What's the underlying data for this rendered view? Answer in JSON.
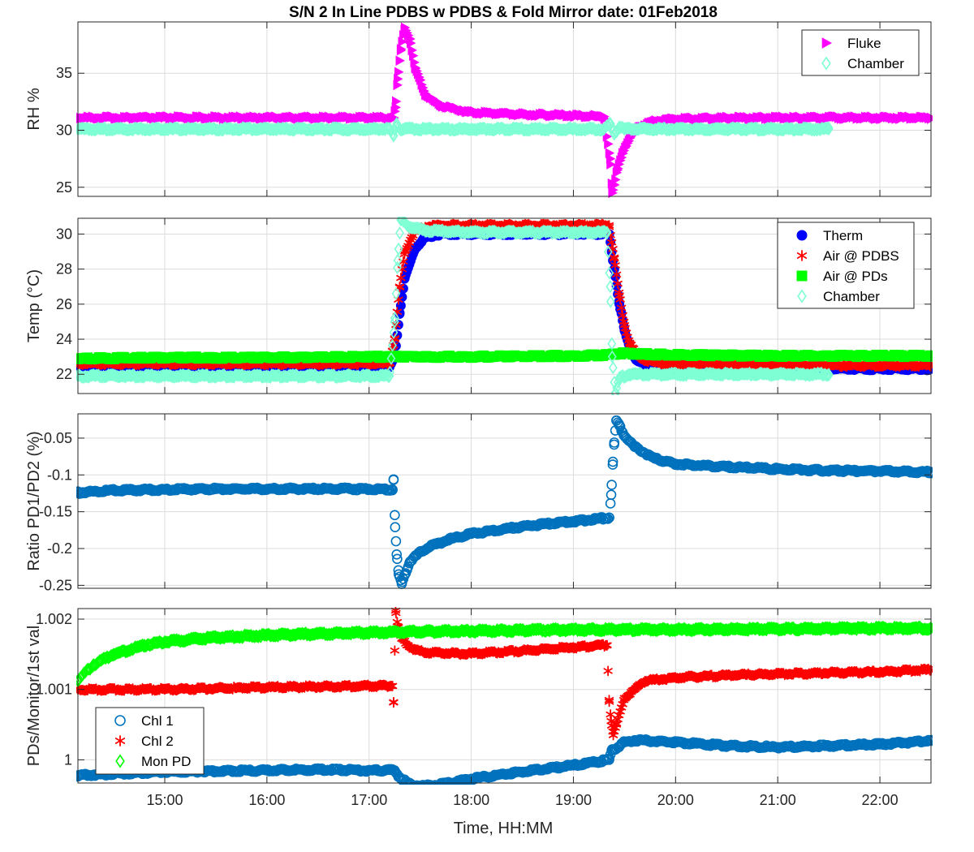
{
  "figure": {
    "title": "S/N 2 In Line PDBS w PDBS & Fold Mirror date: 01Feb2018",
    "xlabel": "Time, HH:MM"
  },
  "chart_data": [
    {
      "type": "scatter",
      "ylabel": "RH %",
      "xlim": [
        14.15,
        22.5
      ],
      "ylim": [
        24.2,
        39.5
      ],
      "yticks": [
        25,
        30,
        35
      ],
      "ytick_labels": [
        "25",
        "30",
        "35"
      ],
      "xticks": [
        15,
        16,
        17,
        18,
        19,
        20,
        21,
        22
      ],
      "xtick_labels": [
        "15:00",
        "16:00",
        "17:00",
        "18:00",
        "19:00",
        "20:00",
        "21:00",
        "22:00"
      ],
      "show_xtick_labels": false,
      "grid": true,
      "legend_position": "top-right",
      "series": [
        {
          "name": "Fluke",
          "marker": "triangle-right",
          "color": "#ff00ff",
          "x": [
            14.15,
            15.0,
            16.0,
            17.0,
            17.24,
            17.26,
            17.28,
            17.31,
            17.35,
            17.4,
            17.45,
            17.55,
            17.7,
            18.0,
            18.5,
            19.0,
            19.3,
            19.36,
            19.38,
            19.4,
            19.43,
            19.48,
            19.55,
            19.65,
            19.8,
            20.0,
            21.0,
            22.0,
            22.5
          ],
          "y": [
            31.1,
            31.1,
            31.1,
            31.1,
            31.1,
            32.0,
            34.5,
            37.0,
            39.0,
            38.0,
            35.5,
            33.2,
            32.2,
            31.6,
            31.4,
            31.3,
            31.2,
            27.5,
            24.5,
            25.2,
            26.5,
            28.0,
            29.3,
            30.3,
            30.8,
            31.0,
            31.1,
            31.1,
            31.1
          ]
        },
        {
          "name": "Chamber",
          "marker": "diamond-open",
          "color": "#7fffd4",
          "x": [
            14.15,
            15.0,
            16.0,
            17.0,
            17.2,
            17.24,
            17.27,
            17.3,
            18.0,
            19.0,
            19.3,
            19.36,
            19.4,
            19.45,
            19.5,
            20.0,
            21.0,
            21.5
          ],
          "y": [
            30.1,
            30.1,
            30.1,
            30.1,
            30.1,
            29.5,
            30.6,
            30.1,
            30.1,
            30.1,
            30.1,
            30.6,
            29.7,
            30.3,
            30.1,
            30.1,
            30.1,
            30.1
          ]
        }
      ]
    },
    {
      "type": "scatter",
      "ylabel": "Temp (°C)",
      "xlim": [
        14.15,
        22.5
      ],
      "ylim": [
        20.9,
        30.9
      ],
      "yticks": [
        22,
        24,
        26,
        28,
        30
      ],
      "ytick_labels": [
        "22",
        "24",
        "26",
        "28",
        "30"
      ],
      "show_xtick_labels": false,
      "grid": true,
      "legend_position": "top-right",
      "series": [
        {
          "name": "Therm",
          "marker": "circle-filled",
          "color": "#0000ff",
          "x": [
            14.15,
            15.0,
            16.0,
            17.0,
            17.2,
            17.25,
            17.3,
            17.35,
            17.45,
            17.55,
            17.7,
            18.0,
            19.0,
            19.35,
            19.4,
            19.45,
            19.5,
            19.55,
            19.62,
            19.7,
            19.85,
            20.0,
            21.0,
            22.0,
            22.5
          ],
          "y": [
            22.4,
            22.4,
            22.4,
            22.4,
            22.4,
            23.0,
            25.5,
            27.5,
            29.2,
            29.8,
            30.0,
            30.0,
            30.0,
            30.0,
            28.0,
            26.0,
            24.5,
            23.5,
            22.8,
            22.5,
            22.4,
            22.35,
            22.3,
            22.3,
            22.3
          ]
        },
        {
          "name": "Air @ PDBS",
          "marker": "asterisk",
          "color": "#ff0000",
          "x": [
            14.15,
            15.0,
            16.0,
            17.0,
            17.2,
            17.25,
            17.3,
            17.35,
            17.45,
            17.55,
            17.7,
            18.0,
            19.0,
            19.35,
            19.4,
            19.45,
            19.5,
            19.55,
            19.62,
            19.7,
            19.85,
            20.0,
            21.0,
            22.0,
            22.5
          ],
          "y": [
            22.6,
            22.6,
            22.6,
            22.6,
            22.6,
            24.0,
            27.0,
            29.0,
            30.2,
            30.4,
            30.5,
            30.5,
            30.5,
            30.5,
            28.6,
            26.5,
            24.8,
            23.8,
            23.1,
            22.8,
            22.6,
            22.6,
            22.5,
            22.5,
            22.5
          ]
        },
        {
          "name": "Air @ PDs",
          "marker": "square-filled",
          "color": "#00ff00",
          "x": [
            14.15,
            15.0,
            16.0,
            17.0,
            18.0,
            19.0,
            19.35,
            19.45,
            20.0,
            21.0,
            22.0,
            22.5
          ],
          "y": [
            22.9,
            22.95,
            22.95,
            23.0,
            23.0,
            23.05,
            23.1,
            23.2,
            23.1,
            23.05,
            23.05,
            23.05
          ]
        },
        {
          "name": "Chamber",
          "marker": "diamond-open",
          "color": "#7fffd4",
          "x": [
            14.15,
            15.0,
            16.0,
            17.0,
            17.2,
            17.25,
            17.28,
            17.31,
            17.4,
            17.55,
            18.0,
            19.0,
            19.33,
            19.36,
            19.38,
            19.41,
            19.45,
            19.55,
            20.0,
            21.0,
            21.5
          ],
          "y": [
            21.9,
            21.9,
            21.9,
            21.9,
            21.9,
            25.0,
            28.5,
            30.8,
            30.4,
            30.2,
            30.1,
            30.1,
            30.1,
            27.0,
            23.0,
            20.9,
            21.8,
            22.0,
            22.0,
            22.0,
            22.0
          ]
        }
      ]
    },
    {
      "type": "scatter",
      "ylabel": "Ratio PD1/PD2 (%)",
      "xlim": [
        14.15,
        22.5
      ],
      "ylim": [
        -0.254,
        -0.017
      ],
      "yticks": [
        -0.25,
        -0.2,
        -0.15,
        -0.1,
        -0.05
      ],
      "ytick_labels": [
        "-0.25",
        "-0.2",
        "-0.15",
        "-0.1",
        "-0.05"
      ],
      "show_xtick_labels": false,
      "grid": true,
      "series": [
        {
          "name": "",
          "marker": "circle-open",
          "color": "#0072bd",
          "x": [
            14.15,
            14.5,
            15.0,
            15.5,
            16.0,
            16.5,
            17.0,
            17.23,
            17.24,
            17.255,
            17.27,
            17.29,
            17.32,
            17.35,
            17.4,
            17.5,
            17.6,
            17.8,
            18.0,
            18.5,
            19.0,
            19.35,
            19.37,
            19.385,
            19.4,
            19.42,
            19.45,
            19.5,
            19.6,
            19.8,
            20.0,
            20.5,
            21.0,
            21.5,
            22.0,
            22.5
          ],
          "y": [
            -0.124,
            -0.121,
            -0.12,
            -0.119,
            -0.119,
            -0.119,
            -0.119,
            -0.12,
            -0.106,
            -0.171,
            -0.208,
            -0.235,
            -0.248,
            -0.235,
            -0.218,
            -0.205,
            -0.197,
            -0.187,
            -0.18,
            -0.17,
            -0.163,
            -0.158,
            -0.127,
            -0.086,
            -0.056,
            -0.026,
            -0.033,
            -0.047,
            -0.062,
            -0.078,
            -0.085,
            -0.089,
            -0.092,
            -0.094,
            -0.095,
            -0.096
          ]
        }
      ]
    },
    {
      "type": "scatter",
      "ylabel": "PDs/Monitor/1st val",
      "xlim": [
        14.15,
        22.5
      ],
      "ylim": [
        0.99967,
        1.00215
      ],
      "yticks": [
        1.0,
        1.001,
        1.002
      ],
      "ytick_labels": [
        "1",
        "1.001",
        "1.002"
      ],
      "xticks": [
        15,
        16,
        17,
        18,
        19,
        20,
        21,
        22
      ],
      "xtick_labels": [
        "15:00",
        "16:00",
        "17:00",
        "18:00",
        "19:00",
        "20:00",
        "21:00",
        "22:00"
      ],
      "show_xtick_labels": true,
      "grid": true,
      "legend_position": "bottom-left",
      "series": [
        {
          "name": "Chl 1",
          "marker": "circle-open",
          "color": "#0072bd",
          "x": [
            14.15,
            15.0,
            16.0,
            16.5,
            17.0,
            17.25,
            17.3,
            17.4,
            17.5,
            17.7,
            18.0,
            18.5,
            19.0,
            19.35,
            19.38,
            19.4,
            19.5,
            19.6,
            20.0,
            20.5,
            21.0,
            22.0,
            22.5
          ],
          "y": [
            0.99978,
            0.99983,
            0.99985,
            0.99986,
            0.99985,
            0.99985,
            0.99975,
            0.99965,
            0.99963,
            0.99965,
            0.99973,
            0.99983,
            0.99992,
            1.0,
            1.00015,
            1.00015,
            1.00025,
            1.00028,
            1.00025,
            1.0002,
            1.00018,
            1.00022,
            1.00027
          ]
        },
        {
          "name": "Chl 2",
          "marker": "asterisk",
          "color": "#ff0000",
          "x": [
            14.15,
            15.0,
            16.0,
            17.0,
            17.23,
            17.24,
            17.26,
            17.28,
            17.32,
            17.38,
            17.45,
            17.6,
            18.0,
            18.5,
            19.0,
            19.33,
            19.35,
            19.37,
            19.39,
            19.42,
            19.5,
            19.7,
            20.0,
            20.5,
            21.0,
            22.0,
            22.5
          ],
          "y": [
            1.001,
            1.001,
            1.00103,
            1.00105,
            1.00105,
            1.00082,
            1.00212,
            1.0019,
            1.00172,
            1.00163,
            1.00156,
            1.00152,
            1.00151,
            1.00155,
            1.0016,
            1.00163,
            1.00085,
            1.00055,
            1.00035,
            1.0005,
            1.00088,
            1.00112,
            1.00117,
            1.0012,
            1.00122,
            1.00125,
            1.00128
          ]
        },
        {
          "name": "Mon PD",
          "marker": "diamond-open",
          "color": "#00ff00",
          "x": [
            14.15,
            14.3,
            14.5,
            14.8,
            15.0,
            15.5,
            16.0,
            17.0,
            18.0,
            19.0,
            20.0,
            21.0,
            22.0,
            22.5
          ],
          "y": [
            1.00113,
            1.00135,
            1.0015,
            1.00163,
            1.00168,
            1.00174,
            1.00177,
            1.00181,
            1.00183,
            1.00185,
            1.00185,
            1.00186,
            1.00187,
            1.00187
          ]
        }
      ]
    }
  ]
}
